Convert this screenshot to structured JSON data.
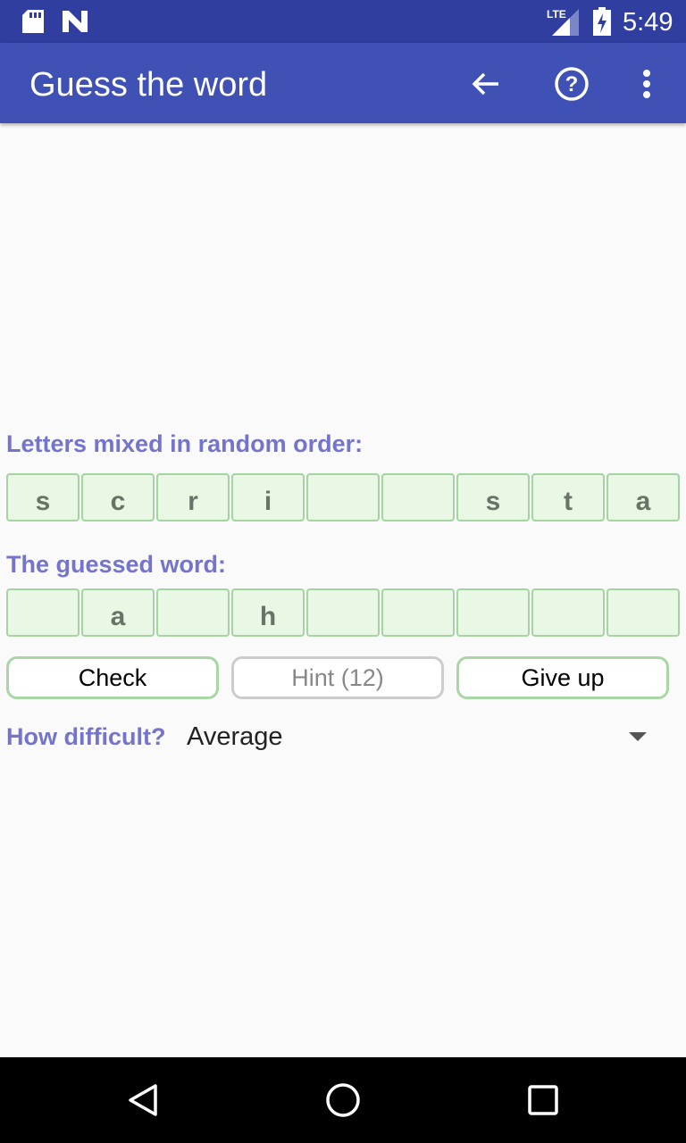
{
  "status_bar": {
    "time": "5:49",
    "network": "LTE",
    "icons": [
      "sd-card-icon",
      "n-notification-icon",
      "signal-icon",
      "battery-charging-icon"
    ]
  },
  "app_bar": {
    "title": "Guess the word",
    "actions": [
      "back-arrow-icon",
      "help-icon",
      "more-vert-icon"
    ]
  },
  "mixed": {
    "label": "Letters mixed in random order:",
    "letters": [
      "s",
      "c",
      "r",
      "i",
      "",
      "",
      "s",
      "t",
      "a"
    ]
  },
  "guessed": {
    "label": "The guessed word:",
    "letters": [
      "",
      "a",
      "",
      "h",
      "",
      "",
      "",
      "",
      ""
    ]
  },
  "buttons": {
    "check": "Check",
    "hint": "Hint (12)",
    "give_up": "Give up"
  },
  "difficulty": {
    "label": "How difficult?",
    "value": "Average"
  },
  "colors": {
    "primary": "#3f51b5",
    "primary_dark": "#303f9f",
    "label": "#7474cc",
    "tile_bg": "#e8f8e4",
    "tile_border": "#a4d4a0"
  }
}
